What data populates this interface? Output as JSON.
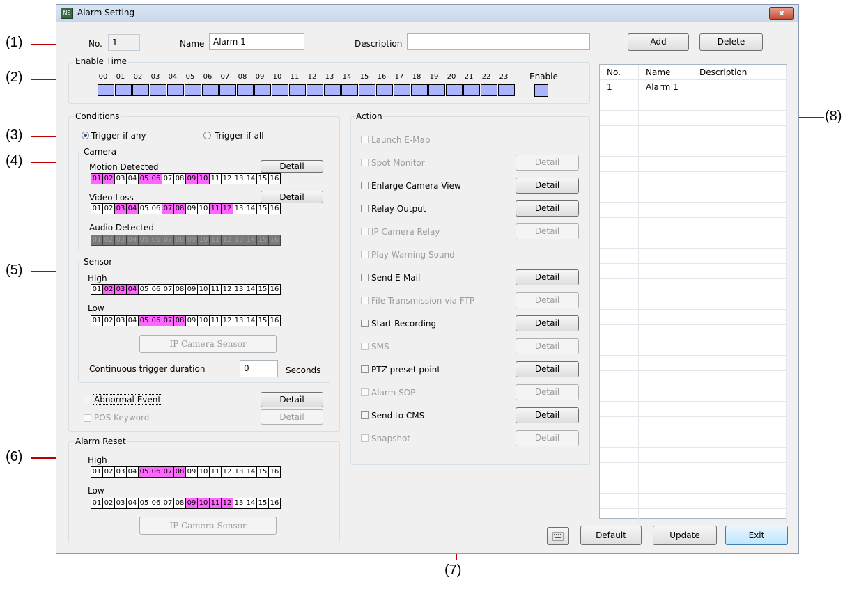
{
  "window": {
    "title": "Alarm Setting",
    "close": "x"
  },
  "callouts": [
    "(1)",
    "(2)",
    "(3)",
    "(4)",
    "(5)",
    "(6)",
    "(7)",
    "(8)"
  ],
  "top": {
    "no_label": "No.",
    "no_value": "1",
    "name_label": "Name",
    "name_value": "Alarm 1",
    "desc_label": "Description",
    "desc_value": "",
    "add": "Add",
    "delete": "Delete"
  },
  "enable_time": {
    "title": "Enable Time",
    "hours": [
      "00",
      "01",
      "02",
      "03",
      "04",
      "05",
      "06",
      "07",
      "08",
      "09",
      "10",
      "11",
      "12",
      "13",
      "14",
      "15",
      "16",
      "17",
      "18",
      "19",
      "20",
      "21",
      "22",
      "23"
    ],
    "enable_label": "Enable"
  },
  "conditions": {
    "title": "Conditions",
    "trigger_any": "Trigger if any",
    "trigger_all": "Trigger if all",
    "camera_title": "Camera",
    "motion_label": "Motion Detected",
    "video_loss_label": "Video Loss",
    "audio_label": "Audio Detected",
    "detail": "Detail",
    "sensor_title": "Sensor",
    "high": "High",
    "low": "Low",
    "ip_camera_sensor": "IP Camera Sensor",
    "continuous_label": "Continuous trigger duration",
    "continuous_value": "0",
    "seconds": "Seconds",
    "abnormal_event": "Abnormal Event",
    "pos_keyword": "POS Keyword"
  },
  "alarm_reset": {
    "title": "Alarm Reset",
    "high": "High",
    "low": "Low",
    "ip_camera_sensor": "IP Camera Sensor"
  },
  "channels": [
    "01",
    "02",
    "03",
    "04",
    "05",
    "06",
    "07",
    "08",
    "09",
    "10",
    "11",
    "12",
    "13",
    "14",
    "15",
    "16"
  ],
  "strips": {
    "motion": [
      1,
      2,
      5,
      6,
      9,
      10
    ],
    "video_loss": [
      3,
      4,
      7,
      8,
      11,
      12
    ],
    "sensor_high": [
      2,
      3,
      4
    ],
    "sensor_low": [
      5,
      6,
      7,
      8
    ],
    "reset_high": [
      5,
      6,
      7,
      8
    ],
    "reset_low": [
      9,
      10,
      11,
      12
    ]
  },
  "action": {
    "title": "Action",
    "detail": "Detail",
    "items": [
      {
        "label": "Launch E-Map",
        "enabled": false,
        "detail": false
      },
      {
        "label": "Spot Monitor",
        "enabled": false,
        "detail": true
      },
      {
        "label": "Enlarge Camera View",
        "enabled": true,
        "detail": true
      },
      {
        "label": "Relay Output",
        "enabled": true,
        "detail": true
      },
      {
        "label": "IP Camera Relay",
        "enabled": false,
        "detail": true
      },
      {
        "label": "Play Warning Sound",
        "enabled": false,
        "detail": false
      },
      {
        "label": "Send E-Mail",
        "enabled": true,
        "detail": true
      },
      {
        "label": "File Transmission via FTP",
        "enabled": false,
        "detail": true
      },
      {
        "label": "Start Recording",
        "enabled": true,
        "detail": true
      },
      {
        "label": "SMS",
        "enabled": false,
        "detail": true
      },
      {
        "label": "PTZ preset point",
        "enabled": true,
        "detail": true
      },
      {
        "label": "Alarm SOP",
        "enabled": false,
        "detail": true
      },
      {
        "label": "Send to CMS",
        "enabled": true,
        "detail": true
      },
      {
        "label": "Snapshot",
        "enabled": false,
        "detail": true
      }
    ]
  },
  "list": {
    "headers": [
      "No.",
      "Name",
      "Description"
    ],
    "rows": [
      [
        "1",
        "Alarm 1",
        ""
      ]
    ]
  },
  "bottom": {
    "default": "Default",
    "update": "Update",
    "exit": "Exit"
  },
  "colors": {
    "channel_on": "#ff66ff",
    "hour_cell": "#aab4ff",
    "callout_line": "#c00000"
  }
}
